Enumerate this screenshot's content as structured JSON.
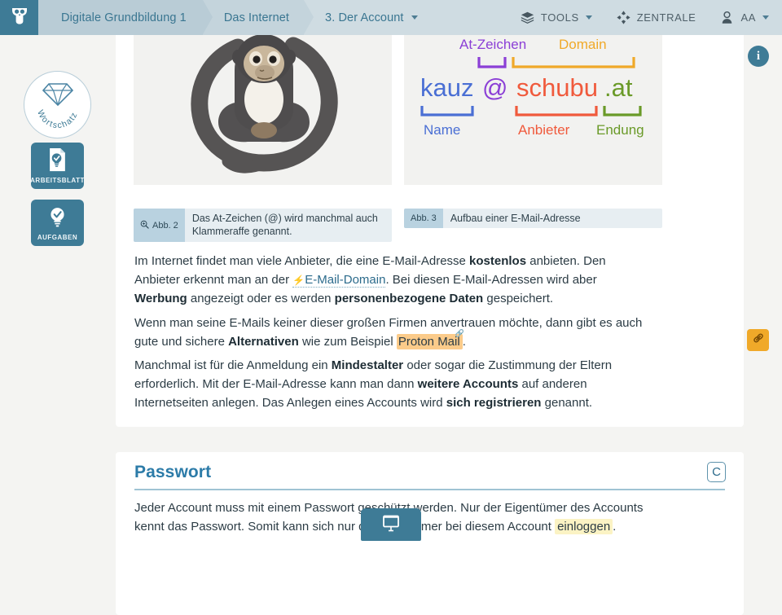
{
  "header": {
    "logo_icon": "owl-logo-icon",
    "breadcrumbs": [
      {
        "label": "Digitale Grundbildung 1",
        "has_caret": false
      },
      {
        "label": "Das Internet",
        "has_caret": false
      },
      {
        "label": "3. Der Account",
        "has_caret": true
      }
    ],
    "right_items": [
      {
        "label": "TOOLS",
        "icon": "layers-icon",
        "has_caret": true
      },
      {
        "label": "ZENTRALE",
        "icon": "burst-icon",
        "has_caret": false
      },
      {
        "label": "AA",
        "icon": "user-avatar-icon",
        "has_caret": true
      }
    ]
  },
  "left_rail": {
    "wortschatz": {
      "label": "Wortschatz",
      "icon": "diamond-icon"
    },
    "buttons": [
      {
        "label": "ARBEITSBLATT",
        "icon": "worksheet-bulb-icon"
      },
      {
        "label": "AUFGABEN",
        "icon": "bulb-check-icon"
      }
    ]
  },
  "figures": {
    "fig2": {
      "tag": "Abb. 2",
      "tag_icon": "magnifier-plus-icon",
      "caption": "Das At-Zeichen (@) wird manchmal auch Klammeraffe genannt.",
      "illustration": "monkey-forming-at-sign"
    },
    "fig3": {
      "tag": "Abb. 3",
      "caption": "Aufbau einer E-Mail-Adresse",
      "diagram": {
        "type": "email-address-anatomy",
        "parts": [
          {
            "text": "kauz",
            "label": "Name",
            "label_pos": "below",
            "color": "#4a6fd4"
          },
          {
            "text": "@",
            "label": "At-Zeichen",
            "label_pos": "above",
            "color": "#8b3fd6"
          },
          {
            "text": "schubu",
            "label": "Anbieter",
            "label_pos": "below",
            "color": "#f05a3c"
          },
          {
            "text": ".at",
            "label": "Endung",
            "label_pos": "below",
            "color": "#6a9a28"
          }
        ],
        "group_label": {
          "text": "Domain",
          "color": "#f0a929",
          "covers": [
            "schubu",
            ".at"
          ]
        }
      }
    }
  },
  "paragraphs": {
    "p1": {
      "s1": "Im Internet findet man viele Anbieter, die eine E-Mail-Adresse ",
      "b1": "kostenlos",
      "s2": " anbieten. Den Anbieter erkennt man an der ",
      "link": "E-Mail-Domain",
      "link_icon": "lightning-bolt-icon",
      "s3": ". Bei diesen E-Mail-Adressen wird aber ",
      "b2": "Werbung",
      "s4": " angezeigt oder es werden ",
      "b3": "personenbezogene Daten",
      "s5": " gespeichert."
    },
    "p2": {
      "s1": "Wenn man seine E-Mails keiner dieser großen Firmen anvertrauen möchte, dann gibt es auch gute und sichere ",
      "b1": "Alternativen",
      "s2": " wie zum Beispiel ",
      "hl1": "Proton Mail",
      "hl1_icon": "link-pin-icon",
      "s3": "."
    },
    "p3": {
      "s1": "Manchmal ist für die Anmeldung ein ",
      "b1": "Mindestalter",
      "s2": " oder sogar die Zustimmung der Eltern erforderlich. Mit der E-Mail-Adresse kann man dann ",
      "b2": "weitere Accounts",
      "s3": " auf anderen Internetseiten anlegen. Das Anlegen eines Accounts wird ",
      "b3": "sich registrieren",
      "s4": " genannt."
    }
  },
  "passwort_section": {
    "title": "Passwort",
    "badge": "C",
    "body": {
      "s1": "Jeder Account muss mit einem Passwort geschützt werden. Nur der Eigentümer des Accounts kennt das Passwort. Somit kann sich nur der Eigentümer bei diesem Account ",
      "hl1": "einloggen",
      "s2": "."
    }
  },
  "floating": {
    "info_button": {
      "label": "i",
      "icon": "info-icon"
    },
    "link_button": {
      "icon": "chain-link-icon"
    },
    "present_button": {
      "icon": "presentation-screen-icon"
    }
  },
  "colors": {
    "header_bg": "#cfdce2",
    "accent_blue": "#3e7b96",
    "title_blue": "#2c7ba8",
    "page_bg": "#f4f4f2",
    "card_bg": "#ffffff",
    "highlight_orange": "#fbcb8a",
    "highlight_yellow": "#fbf3c4",
    "link_button_orange": "#f0a929"
  }
}
